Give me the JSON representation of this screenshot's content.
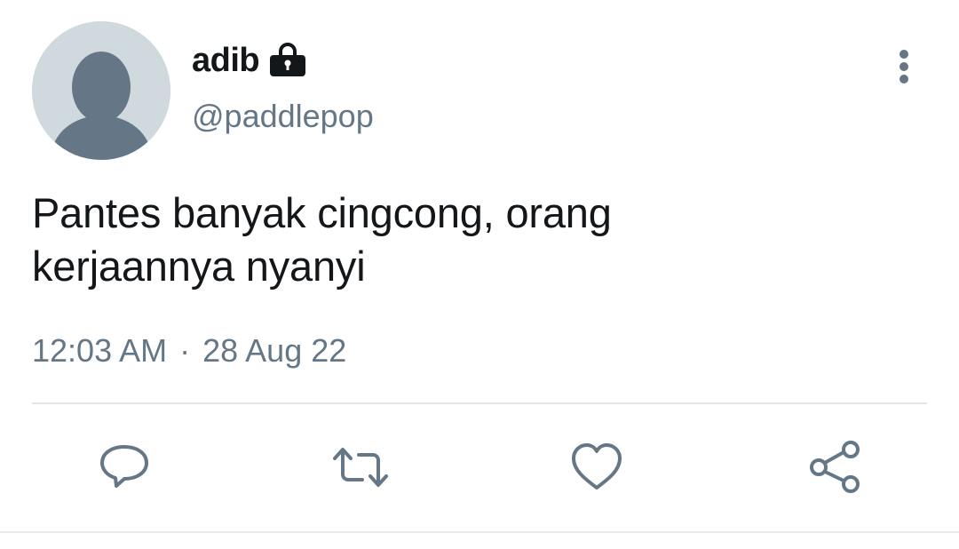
{
  "tweet": {
    "display_name": "adib",
    "handle": "@paddlepop",
    "protected_icon": "lock-icon",
    "text_lines": [
      "Pantes banyak cingcong, orang",
      "kerjaannya nyanyi"
    ],
    "time": "12:03 AM",
    "separator": "·",
    "date": "28 Aug 22"
  },
  "actions": {
    "icons": [
      "reply-icon",
      "retweet-icon",
      "like-icon",
      "share-icon"
    ],
    "more_icon": "more-vertical-icon"
  },
  "colors": {
    "text_primary": "#14171a",
    "text_secondary": "#657786",
    "avatar_bg": "#cfd9de",
    "avatar_fg": "#657786",
    "divider": "#e1e8ed"
  }
}
